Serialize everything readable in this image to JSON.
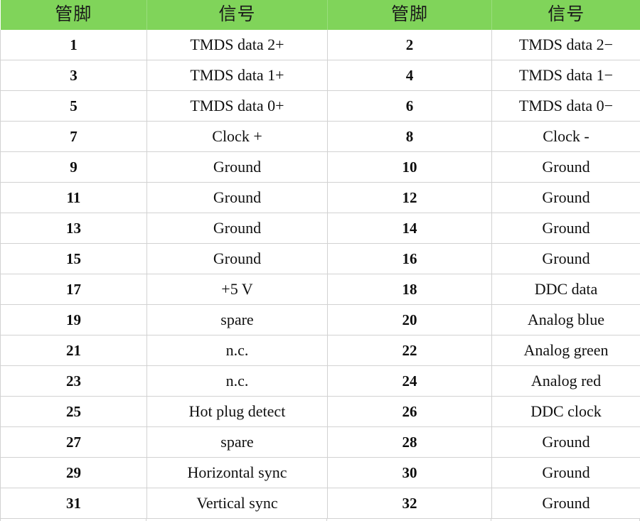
{
  "table": {
    "headers": [
      "管脚",
      "信号",
      "管脚",
      "信号"
    ],
    "header_background": "#80d45a",
    "grid_color": "#d2d2d2",
    "rows": [
      {
        "pin_left": "1",
        "signal_left": "TMDS data 2+",
        "pin_right": "2",
        "signal_right": "TMDS data 2−"
      },
      {
        "pin_left": "3",
        "signal_left": "TMDS data 1+",
        "pin_right": "4",
        "signal_right": "TMDS data 1−"
      },
      {
        "pin_left": "5",
        "signal_left": "TMDS data 0+",
        "pin_right": "6",
        "signal_right": "TMDS data 0−"
      },
      {
        "pin_left": "7",
        "signal_left": "Clock +",
        "pin_right": "8",
        "signal_right": "Clock -"
      },
      {
        "pin_left": "9",
        "signal_left": "Ground",
        "pin_right": "10",
        "signal_right": "Ground"
      },
      {
        "pin_left": "11",
        "signal_left": "Ground",
        "pin_right": "12",
        "signal_right": "Ground"
      },
      {
        "pin_left": "13",
        "signal_left": "Ground",
        "pin_right": "14",
        "signal_right": "Ground"
      },
      {
        "pin_left": "15",
        "signal_left": "Ground",
        "pin_right": "16",
        "signal_right": "Ground"
      },
      {
        "pin_left": "17",
        "signal_left": "+5 V",
        "pin_right": "18",
        "signal_right": "DDC data"
      },
      {
        "pin_left": "19",
        "signal_left": "spare",
        "pin_right": "20",
        "signal_right": "Analog blue"
      },
      {
        "pin_left": "21",
        "signal_left": "n.c.",
        "pin_right": "22",
        "signal_right": "Analog green"
      },
      {
        "pin_left": "23",
        "signal_left": "n.c.",
        "pin_right": "24",
        "signal_right": "Analog red"
      },
      {
        "pin_left": "25",
        "signal_left": "Hot plug detect",
        "pin_right": "26",
        "signal_right": "DDC clock"
      },
      {
        "pin_left": "27",
        "signal_left": "spare",
        "pin_right": "28",
        "signal_right": "Ground"
      },
      {
        "pin_left": "29",
        "signal_left": "Horizontal sync",
        "pin_right": "30",
        "signal_right": "Ground"
      },
      {
        "pin_left": "31",
        "signal_left": "Vertical sync",
        "pin_right": "32",
        "signal_right": "Ground"
      }
    ]
  }
}
